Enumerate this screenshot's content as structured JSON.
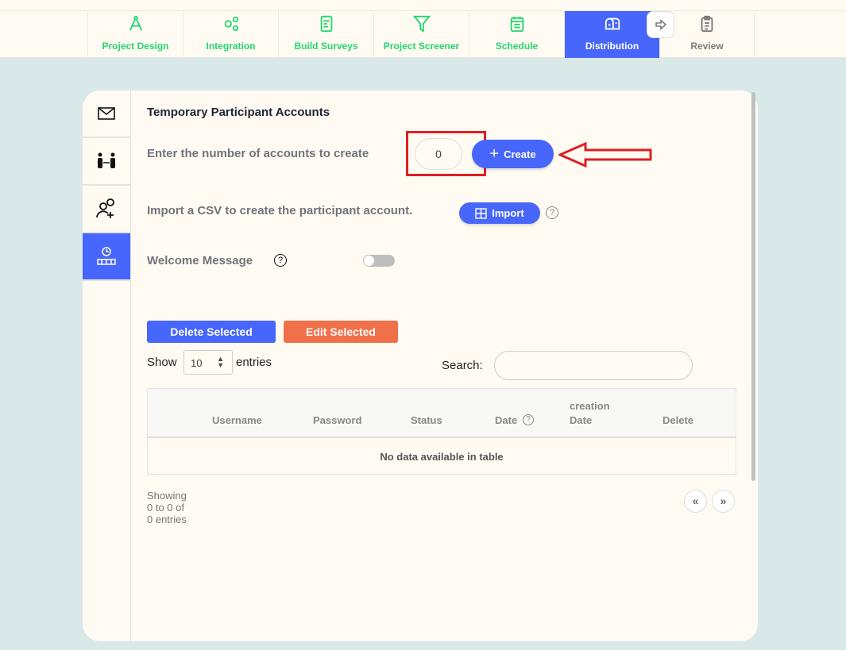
{
  "nav": {
    "tabs": [
      {
        "label": "Project Design",
        "icon": "compass-icon"
      },
      {
        "label": "Integration",
        "icon": "gears-icon"
      },
      {
        "label": "Build Surveys",
        "icon": "document-icon"
      },
      {
        "label": "Project Screener",
        "icon": "filter-icon"
      },
      {
        "label": "Schedule",
        "icon": "calendar-icon"
      },
      {
        "label": "Distribution",
        "icon": "mailbox-icon",
        "active": true
      },
      {
        "label": "Review",
        "icon": "clipboard-icon"
      }
    ]
  },
  "sidebar": {
    "items": [
      {
        "icon": "envelope-icon"
      },
      {
        "icon": "people-exchange-icon"
      },
      {
        "icon": "add-user-icon"
      },
      {
        "icon": "temporary-account-icon",
        "active": true
      }
    ]
  },
  "main": {
    "title": "Temporary Participant Accounts",
    "count_label": "Enter the number of accounts to create",
    "count_value": "0",
    "create_label": "Create",
    "import_text": "Import a CSV to create the participant account.",
    "import_label": "Import",
    "welcome_label": "Welcome Message",
    "welcome_enabled": false,
    "help": "?",
    "delete_selected": "Delete Selected",
    "edit_selected": "Edit Selected",
    "show": "Show",
    "entries_value": "10",
    "entries": "entries",
    "search_label": "Search:",
    "search_value": "",
    "columns": {
      "username": "Username",
      "password": "Password",
      "status": "Status",
      "date": "Date",
      "creation1": "creation",
      "creation2": "Date",
      "delete": "Delete"
    },
    "empty": "No data available in table",
    "info": "Showing 0 to 0 of 0 entries",
    "prev": "«",
    "next": "»"
  },
  "colors": {
    "accent": "#4766fb",
    "green": "#22d66f",
    "orange": "#f0704a",
    "annotation": "#e01e24"
  }
}
